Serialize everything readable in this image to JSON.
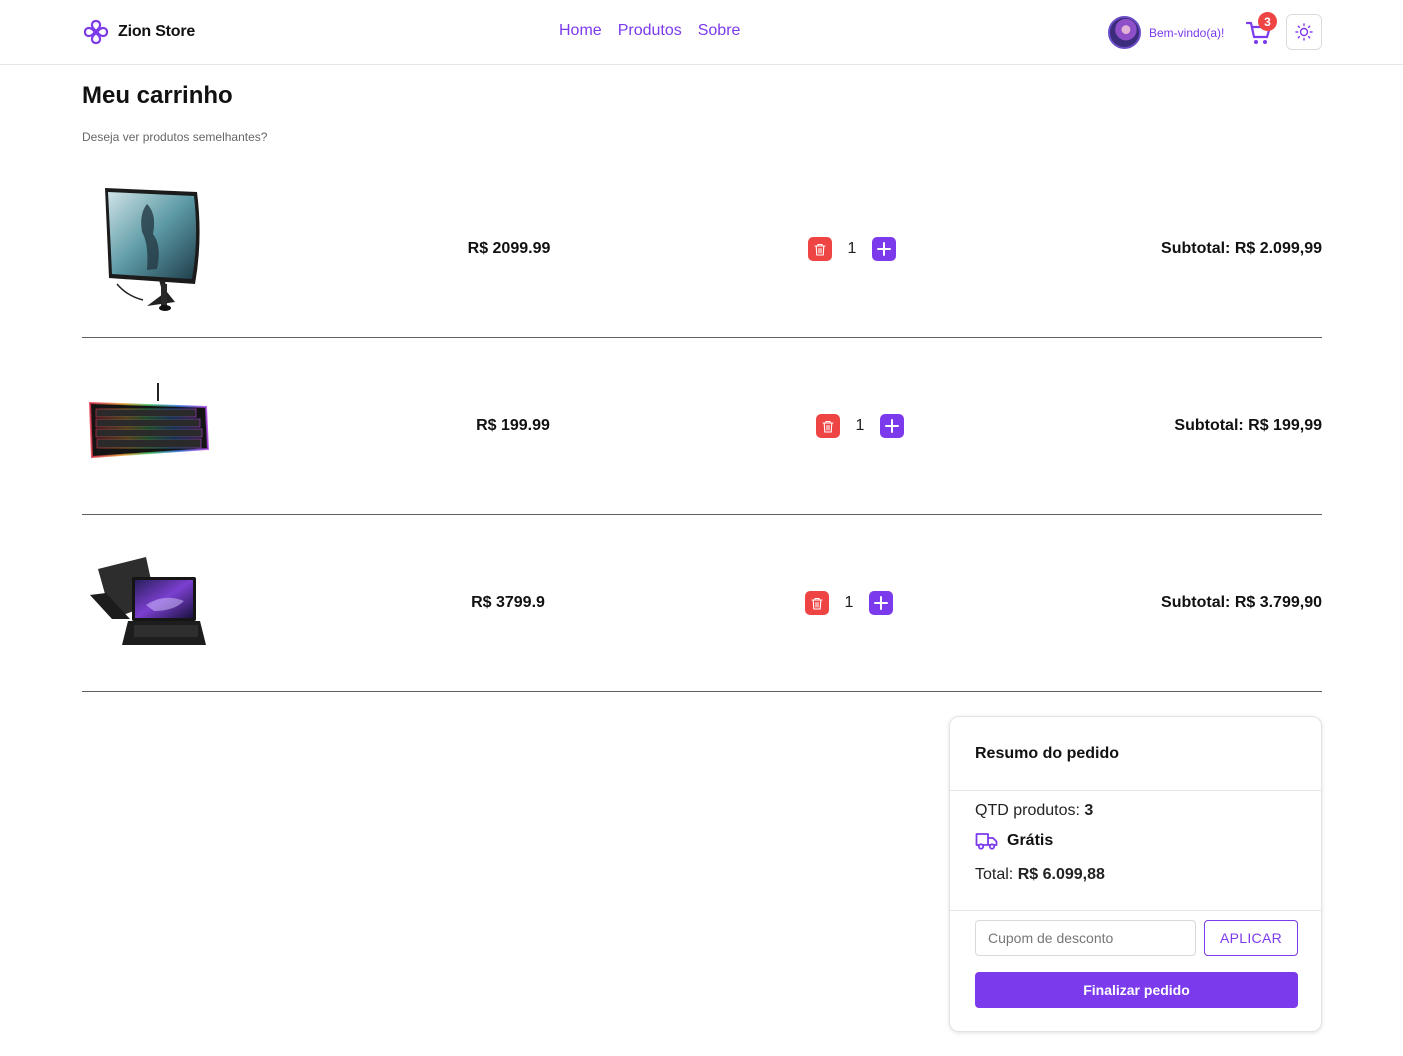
{
  "header": {
    "brand_name": "Zion Store",
    "nav": [
      "Home",
      "Produtos",
      "Sobre"
    ],
    "welcome": "Bem-vindo(a)!",
    "cart_count": "3"
  },
  "page": {
    "title": "Meu carrinho",
    "subtitle": "Deseja ver produtos semelhantes?"
  },
  "cart_items": [
    {
      "product_icon": "monitor",
      "price": "R$ 2099.99",
      "quantity": "1",
      "subtotal": "Subtotal: R$ 2.099,99"
    },
    {
      "product_icon": "keyboard",
      "price": "R$ 199.99",
      "quantity": "1",
      "subtotal": "Subtotal: R$ 199,99"
    },
    {
      "product_icon": "laptop",
      "price": "R$ 3799.9",
      "quantity": "1",
      "subtotal": "Subtotal: R$ 3.799,90"
    }
  ],
  "summary": {
    "title": "Resumo do pedido",
    "qty_label": "QTD produtos:",
    "qty_value": "3",
    "shipping": "Grátis",
    "total_label": "Total:",
    "total_value": "R$ 6.099,88",
    "coupon_placeholder": "Cupom de desconto",
    "apply_label": "APLICAR",
    "finish_label": "Finalizar pedido"
  },
  "colors": {
    "accent": "#7c3aed",
    "danger": "#ef4444"
  }
}
